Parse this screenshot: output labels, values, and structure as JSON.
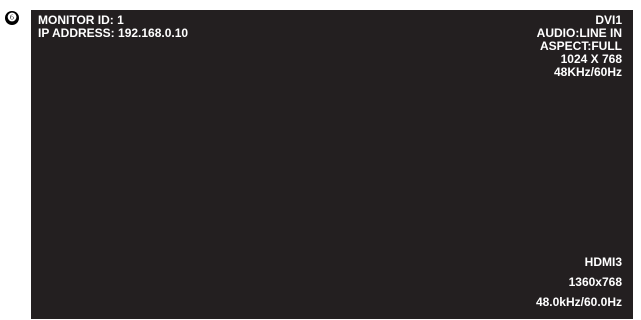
{
  "callout": {
    "number": "❻"
  },
  "osd": {
    "monitor_id": "MONITOR ID: 1",
    "ip_address": "IP ADDRESS: 192.168.0.10",
    "top_right": {
      "input": "DVI1",
      "audio": "AUDIO:LINE IN",
      "aspect": "ASPECT:FULL",
      "resolution": "1024 X 768",
      "frequency": "48KHz/60Hz"
    },
    "bottom_right": {
      "input": "HDMI3",
      "resolution": "1360x768",
      "frequency": "48.0kHz/60.0Hz"
    }
  },
  "colors": {
    "screen_background": "#231f20",
    "osd_text": "#ffffff",
    "page_background": "#ffffff"
  }
}
